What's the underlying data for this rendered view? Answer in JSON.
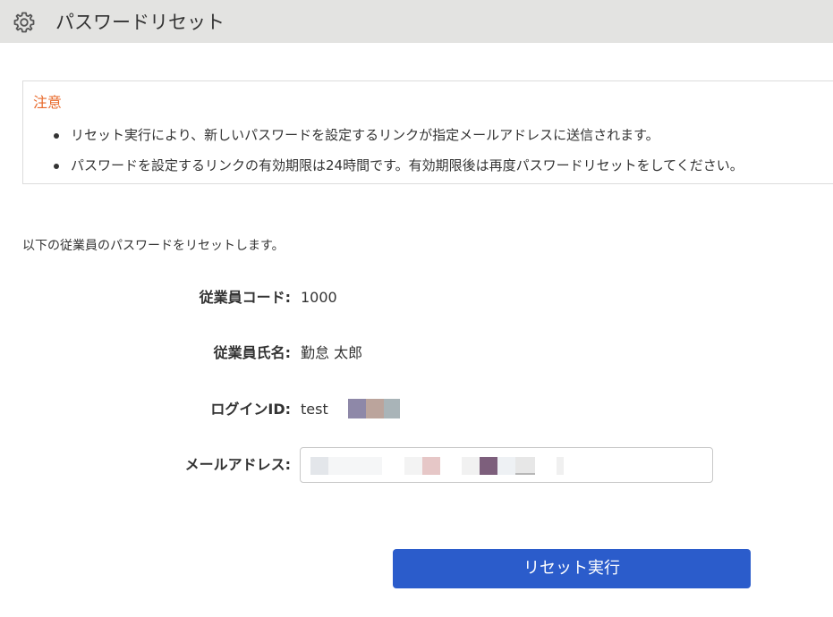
{
  "header": {
    "icon": "gear-icon",
    "title": "パスワードリセット",
    "background": "#e3e3e1"
  },
  "notice": {
    "title": "注意",
    "title_color": "#e8692a",
    "items": [
      "リセット実行により、新しいパスワードを設定するリンクが指定メールアドレスに送信されます。",
      "パスワードを設定するリンクの有効期限は24時間です。有効期限後は再度パスワードリセットをしてください。"
    ]
  },
  "intro_text": "以下の従業員のパスワードをリセットします。",
  "fields": {
    "employee_code": {
      "label": "従業員コード:",
      "value": "1000"
    },
    "employee_name": {
      "label": "従業員氏名:",
      "value": "勤怠 太郎"
    },
    "login_id": {
      "label": "ログインID:",
      "value": "test"
    },
    "email": {
      "label": "メールアドレス:",
      "value": ""
    }
  },
  "reset_button": {
    "label": "リセット実行",
    "color": "#2b5ccb"
  }
}
